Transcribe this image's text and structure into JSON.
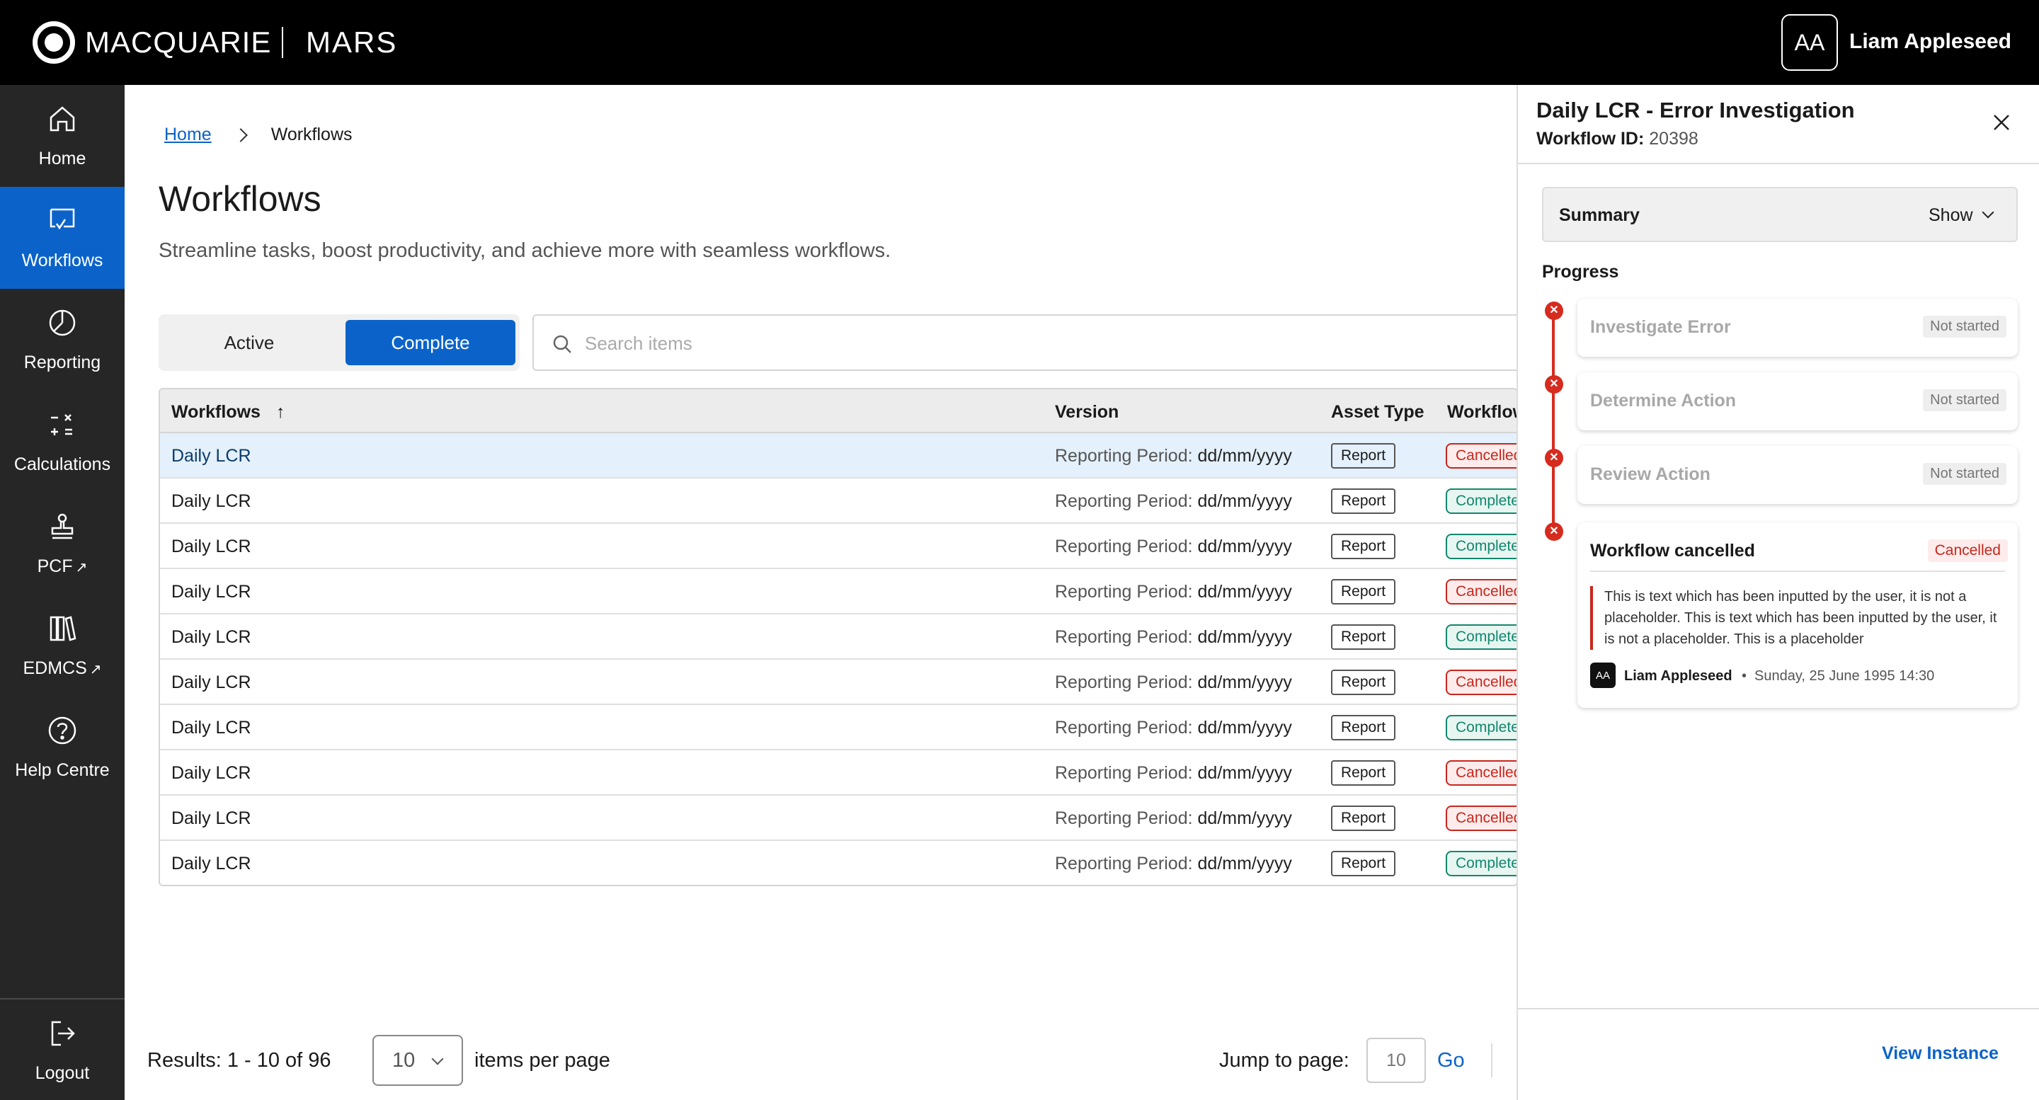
{
  "header": {
    "brand": "MACQUARIE",
    "app_name": "MARS",
    "user_initials": "AA",
    "user_name": "Liam Appleseed"
  },
  "sidebar": {
    "items": [
      {
        "label": "Home",
        "icon": "home-icon",
        "active": false
      },
      {
        "label": "Workflows",
        "icon": "workflow-icon",
        "active": true
      },
      {
        "label": "Reporting",
        "icon": "pie-chart-icon",
        "active": false
      },
      {
        "label": "Calculations",
        "icon": "calculator-icon",
        "active": false
      },
      {
        "label": "PCF",
        "icon": "stamp-icon",
        "active": false,
        "external": true
      },
      {
        "label": "EDMCS",
        "icon": "books-icon",
        "active": false,
        "external": true
      },
      {
        "label": "Help Centre",
        "icon": "help-icon",
        "active": false
      }
    ],
    "logout": {
      "label": "Logout",
      "icon": "logout-icon"
    }
  },
  "breadcrumb": {
    "home": "Home",
    "current": "Workflows"
  },
  "page": {
    "title": "Workflows",
    "subtitle": "Streamline tasks, boost productivity, and achieve more with seamless workflows."
  },
  "toggle": {
    "active_label": "Active",
    "complete_label": "Complete",
    "selected": "Complete"
  },
  "search": {
    "placeholder": "Search items",
    "value": ""
  },
  "table": {
    "headers": {
      "workflows": "Workflows",
      "version": "Version",
      "asset_type": "Asset Type",
      "workflow_status": "Workflow"
    },
    "sort": {
      "column": "Workflows",
      "direction": "ascending"
    },
    "version_label": "Reporting Period:",
    "rows": [
      {
        "name": "Daily LCR",
        "version": "dd/mm/yyyy",
        "asset_type": "Report",
        "status": "Cancelled",
        "highlighted": true
      },
      {
        "name": "Daily LCR",
        "version": "dd/mm/yyyy",
        "asset_type": "Report",
        "status": "Complete"
      },
      {
        "name": "Daily LCR",
        "version": "dd/mm/yyyy",
        "asset_type": "Report",
        "status": "Complete"
      },
      {
        "name": "Daily LCR",
        "version": "dd/mm/yyyy",
        "asset_type": "Report",
        "status": "Cancelled"
      },
      {
        "name": "Daily LCR",
        "version": "dd/mm/yyyy",
        "asset_type": "Report",
        "status": "Complete"
      },
      {
        "name": "Daily LCR",
        "version": "dd/mm/yyyy",
        "asset_type": "Report",
        "status": "Cancelled"
      },
      {
        "name": "Daily LCR",
        "version": "dd/mm/yyyy",
        "asset_type": "Report",
        "status": "Complete"
      },
      {
        "name": "Daily LCR",
        "version": "dd/mm/yyyy",
        "asset_type": "Report",
        "status": "Cancelled"
      },
      {
        "name": "Daily LCR",
        "version": "dd/mm/yyyy",
        "asset_type": "Report",
        "status": "Cancelled"
      },
      {
        "name": "Daily LCR",
        "version": "dd/mm/yyyy",
        "asset_type": "Report",
        "status": "Complete"
      }
    ]
  },
  "pagination": {
    "results": "Results: 1 - 10 of 96",
    "per_page_value": "10",
    "per_page_label": "items per page",
    "jump_label": "Jump to page:",
    "jump_value": "10",
    "go_label": "Go"
  },
  "panel": {
    "title": "Daily LCR - Error Investigation",
    "workflow_id_label": "Workflow ID:",
    "workflow_id": "20398",
    "summary_label": "Summary",
    "summary_toggle": "Show",
    "progress_label": "Progress",
    "steps": [
      {
        "label": "Investigate Error",
        "status": "Not started"
      },
      {
        "label": "Determine Action",
        "status": "Not started"
      },
      {
        "label": "Review Action",
        "status": "Not started"
      }
    ],
    "cancelled": {
      "title": "Workflow cancelled",
      "badge": "Cancelled",
      "note": "This is text which has been inputted by the user, it is not a placeholder. This is text which has been inputted by the user, it is not a placeholder. This is a placeholder",
      "author_initials": "AA",
      "author": "Liam Appleseed",
      "date": "Sunday, 25 June 1995 14:30"
    },
    "view_instance": "View Instance"
  },
  "colors": {
    "primary": "#0b63c9",
    "topbar": "#000000",
    "sidebar": "#262626",
    "cancelled": "#c8261c",
    "complete": "#11876e"
  }
}
